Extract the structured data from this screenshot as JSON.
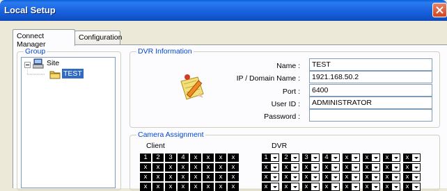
{
  "window": {
    "title": "Local Setup"
  },
  "tabs": [
    {
      "label": "Connect Manager",
      "active": true
    },
    {
      "label": "Configuration",
      "active": false
    }
  ],
  "group": {
    "label": "Group",
    "tree": [
      {
        "label": "Site",
        "icon": "network-folder-icon"
      },
      {
        "label": "TEST",
        "icon": "folder-icon",
        "selected": true
      }
    ]
  },
  "dvr_info": {
    "label": "DVR Information",
    "fields": [
      {
        "label": "Name :",
        "value": "TEST"
      },
      {
        "label": "IP / Domain Name :",
        "value": "1921.168.50.2"
      },
      {
        "label": "Port :",
        "value": "6400"
      },
      {
        "label": "User ID :",
        "value": "ADMINISTRATOR"
      },
      {
        "label": "Password :",
        "value": ""
      }
    ]
  },
  "camera_assignment": {
    "label": "Camera Assignment",
    "client_label": "Client",
    "dvr_label": "DVR",
    "client_rows": [
      [
        "1",
        "2",
        "3",
        "4",
        "x",
        "x",
        "x",
        "x"
      ],
      [
        "x",
        "x",
        "x",
        "x",
        "x",
        "x",
        "x",
        "x"
      ],
      [
        "x",
        "x",
        "x",
        "x",
        "x",
        "x",
        "x",
        "x"
      ],
      [
        "x",
        "x",
        "x",
        "x",
        "x",
        "x",
        "x",
        "x"
      ]
    ],
    "dvr_rows": [
      [
        "1",
        "2",
        "3",
        "4",
        "x",
        "x",
        "x",
        "x"
      ],
      [
        "x",
        "x",
        "x",
        "x",
        "x",
        "x",
        "x",
        "x"
      ],
      [
        "x",
        "x",
        "x",
        "x",
        "x",
        "x",
        "x",
        "x"
      ],
      [
        "x",
        "x",
        "x",
        "x",
        "x",
        "x",
        "x",
        "x"
      ]
    ]
  },
  "colors": {
    "titlebar": "#1b64e0",
    "group_label": "#0046d5",
    "tree_selection": "#316ac5",
    "close_button": "#d1431f"
  }
}
